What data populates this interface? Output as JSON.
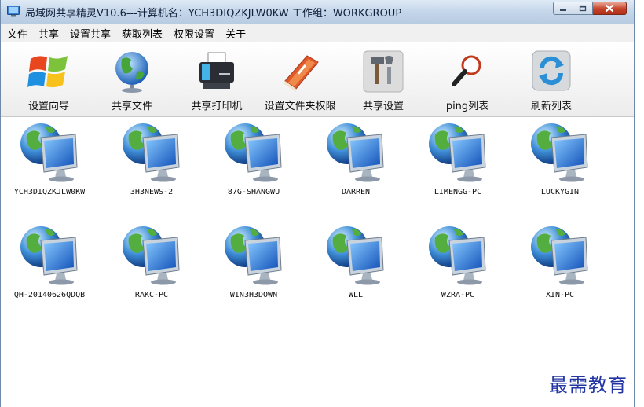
{
  "window": {
    "title": "局域网共享精灵V10.6---计算机名：YCH3DIQZKJLW0KW  工作组：WORKGROUP"
  },
  "menu": {
    "items": [
      "文件",
      "共享",
      "设置共享",
      "获取列表",
      "权限设置",
      "关于"
    ]
  },
  "toolbar": {
    "items": [
      {
        "label": "设置向导",
        "icon": "windows-logo-icon"
      },
      {
        "label": "共享文件",
        "icon": "globe-icon"
      },
      {
        "label": "共享打印机",
        "icon": "printer-icon"
      },
      {
        "label": "设置文件夹权限",
        "icon": "folder-book-icon"
      },
      {
        "label": "共享设置",
        "icon": "tools-icon"
      },
      {
        "label": "ping列表",
        "icon": "magnifier-icon"
      },
      {
        "label": "刷新列表",
        "icon": "refresh-icon"
      }
    ]
  },
  "hosts": [
    "YCH3DIQZKJLW0KW",
    "3H3NEWS-2",
    "87G-SHANGWU",
    "DARREN",
    "LIMENGG-PC",
    "LUCKYGIN",
    "QH-20140626QDQB",
    "RAKC-PC",
    "WIN3H3DOWN",
    "WLL",
    "WZRA-PC",
    "XIN-PC"
  ],
  "watermark": "最需教育",
  "colors": {
    "titlebar": "#c4d6ea",
    "close_button": "#c5422a",
    "watermark": "#2235a3"
  }
}
